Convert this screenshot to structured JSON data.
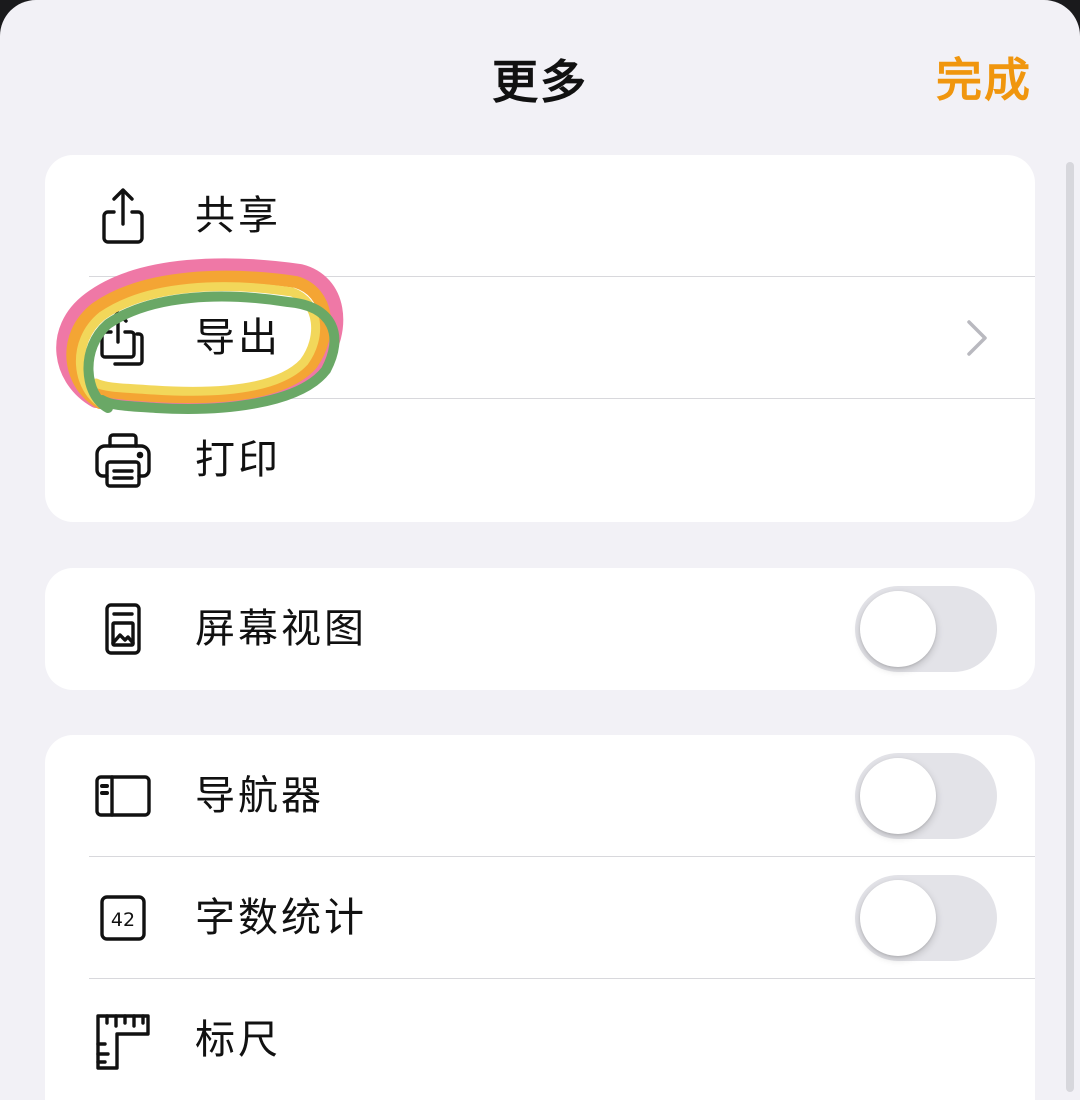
{
  "header": {
    "title": "更多",
    "done_label": "完成"
  },
  "colors": {
    "accent": "#f0960e",
    "background": "#f2f1f6",
    "highlight": [
      "#ef78a6",
      "#f4a534",
      "#f2d75a",
      "#6aa866"
    ]
  },
  "groups": [
    {
      "rows": [
        {
          "label": "共享",
          "icon": "share-icon",
          "accessory": "none"
        },
        {
          "label": "导出",
          "icon": "export-icon",
          "accessory": "chevron-right-icon"
        },
        {
          "label": "打印",
          "icon": "printer-icon",
          "accessory": "none"
        }
      ]
    },
    {
      "rows": [
        {
          "label": "屏幕视图",
          "icon": "screen-view-icon",
          "accessory": "toggle",
          "on": false
        }
      ]
    },
    {
      "rows": [
        {
          "label": "导航器",
          "icon": "navigator-sidebar-icon",
          "accessory": "toggle",
          "on": false
        },
        {
          "label": "字数统计",
          "icon": "word-count-icon",
          "icon_text": "42",
          "accessory": "toggle",
          "on": false
        },
        {
          "label": "标尺",
          "icon": "ruler-icon",
          "accessory": "none"
        }
      ]
    }
  ]
}
